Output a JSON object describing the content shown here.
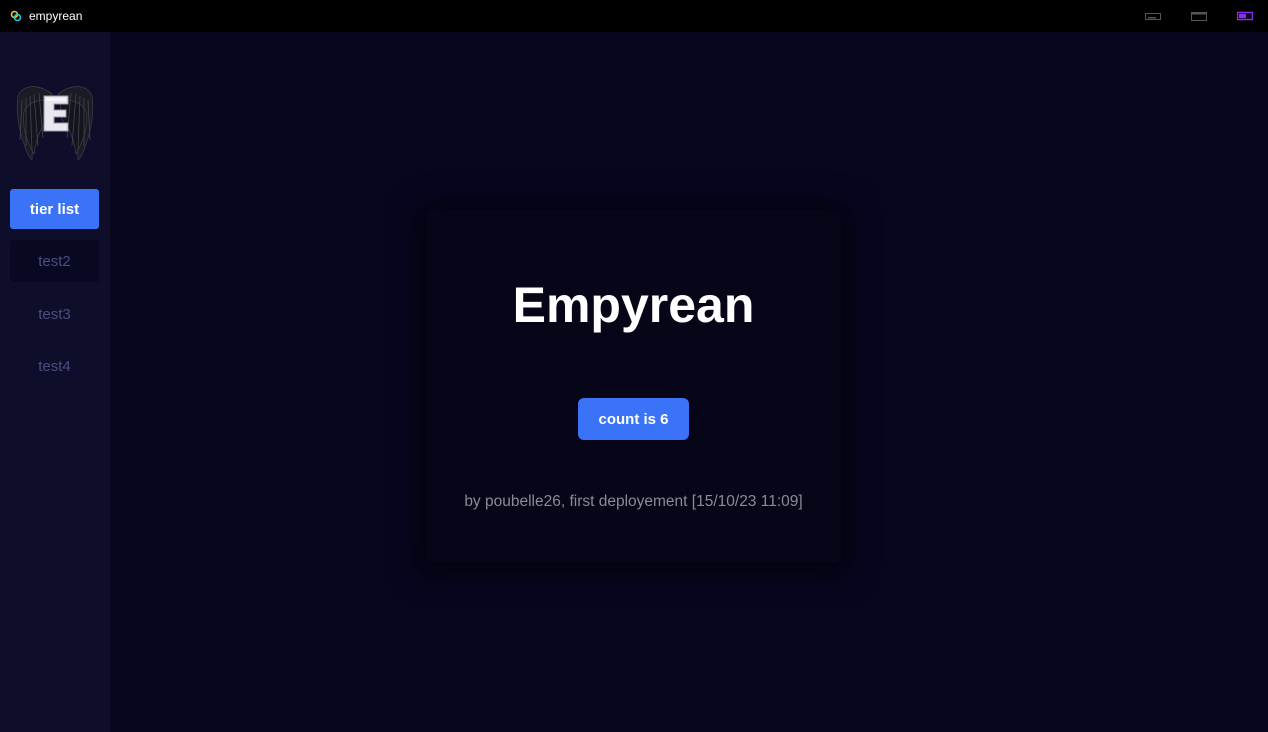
{
  "window": {
    "title": "empyrean",
    "app_icon": "tauri-icon",
    "controls": [
      "minimize-icon",
      "maximize-icon",
      "close-icon"
    ],
    "accent_color": "#8b2cf5"
  },
  "sidebar": {
    "logo_letter": "E",
    "items": [
      {
        "label": "tier list",
        "state": "active"
      },
      {
        "label": "test2",
        "state": "hover"
      },
      {
        "label": "test3",
        "state": "normal"
      },
      {
        "label": "test4",
        "state": "normal"
      }
    ]
  },
  "main": {
    "title": "Empyrean",
    "count_button_label": "count is 6",
    "credits": "by poubelle26, first deployement [15/10/23 11:09]"
  },
  "colors": {
    "accent": "#3a73f8",
    "background": "#060620",
    "sidebar": "#0e0d2a",
    "inactive_nav_text": "#4d4c7e"
  }
}
